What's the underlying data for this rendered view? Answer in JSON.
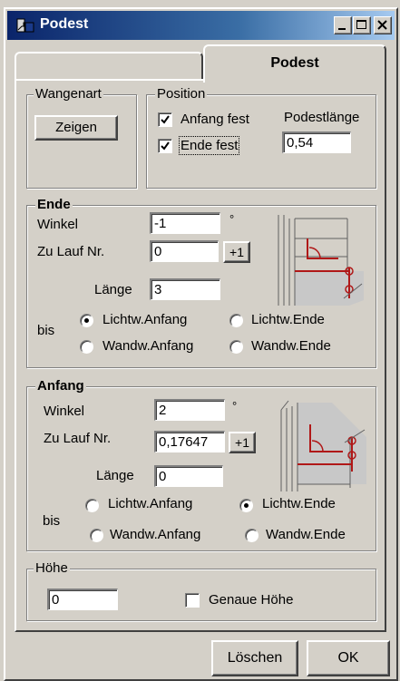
{
  "window": {
    "title": "Podest"
  },
  "tabs": [
    {
      "label": ""
    },
    {
      "label": "Podest"
    }
  ],
  "wangenart": {
    "legend": "Wangenart",
    "zeigen_button": "Zeigen"
  },
  "position": {
    "legend": "Position",
    "anfang_fest_label": "Anfang fest",
    "anfang_fest_checked": true,
    "ende_fest_label": "Ende fest",
    "ende_fest_checked": true,
    "podestlaenge_label": "Podestlänge",
    "podestlaenge_value": "0,54"
  },
  "ende": {
    "legend": "Ende",
    "winkel_label": "Winkel",
    "winkel_value": "-1",
    "degree": "°",
    "zu_lauf_label": "Zu Lauf Nr.",
    "zu_lauf_value": "0",
    "plus_button": "+1",
    "laenge_label": "Länge",
    "laenge_value": "3",
    "bis_label": "bis",
    "options": [
      "Lichtw.Anfang",
      "Lichtw.Ende",
      "Wandw.Anfang",
      "Wandw.Ende"
    ],
    "selected": "Lichtw.Anfang"
  },
  "anfang": {
    "legend": "Anfang",
    "winkel_label": "Winkel",
    "winkel_value": "2",
    "degree": "°",
    "zu_lauf_label": "Zu Lauf Nr.",
    "zu_lauf_value": "0,17647",
    "plus_button": "+1",
    "laenge_label": "Länge",
    "laenge_value": "0",
    "bis_label": "bis",
    "options": [
      "Lichtw.Anfang",
      "Lichtw.Ende",
      "Wandw.Anfang",
      "Wandw.Ende"
    ],
    "selected": "Lichtw.Ende"
  },
  "hoehe": {
    "legend": "Höhe",
    "value": "0",
    "genaue_label": "Genaue Höhe",
    "genaue_checked": false
  },
  "footer": {
    "loeschen_button": "Löschen",
    "ok_button": "OK"
  },
  "colors": {
    "diagram_red": "#b01818",
    "diagram_fill": "#c8c8c8",
    "titlebar_start": "#0a246a"
  }
}
